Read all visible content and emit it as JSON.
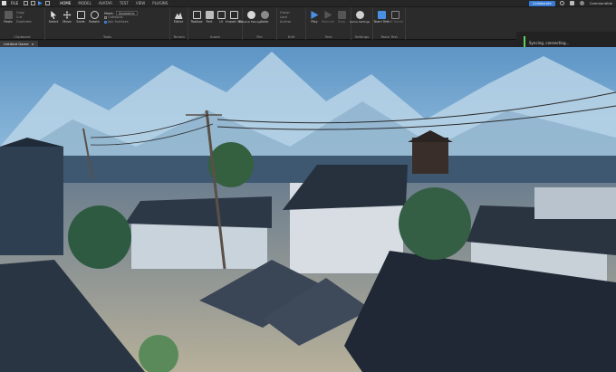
{
  "topbar": {
    "file_label": "FILE",
    "tabs": [
      "HOME",
      "MODEL",
      "AVATAR",
      "TEST",
      "VIEW",
      "PLUGINS"
    ],
    "active_tab": "HOME",
    "collaborate_label": "Collaborate",
    "user_name": "Commandida"
  },
  "ribbon": {
    "clipboard": {
      "label": "Clipboard",
      "items": [
        "Paste",
        "Copy",
        "Cut",
        "Duplicate"
      ]
    },
    "tools": {
      "label": "Tools",
      "items": [
        "Select",
        "Move",
        "Scale",
        "Rotate"
      ],
      "mode_label": "Mode:",
      "mode_value": "Geometric",
      "collisions_label": "Collisions",
      "join_surfaces_label": "Join Surfaces"
    },
    "terrain": {
      "label": "Terrain",
      "items": [
        "Editor"
      ]
    },
    "insert": {
      "label": "Insert",
      "items": [
        "Toolbox",
        "Part",
        "UI",
        "Import 3D"
      ]
    },
    "file": {
      "label": "File",
      "items": [
        "Material Manager",
        "Color"
      ]
    },
    "edit": {
      "label": "Edit",
      "items": [
        "Group",
        "Lock",
        "Anchor"
      ]
    },
    "test": {
      "label": "Test",
      "items": [
        "Play",
        "Resume",
        "Stop"
      ]
    },
    "settings": {
      "label": "Settings",
      "items": [
        "Game Settings"
      ]
    },
    "team_test": {
      "label": "Team Test",
      "items": [
        "Team Test",
        "Exit Game"
      ]
    }
  },
  "notification": {
    "text": "Syncing, connecting..."
  },
  "doc_tabs": [
    {
      "label": "Untitled Game"
    }
  ],
  "colors": {
    "accent": "#3a7bd5",
    "toolbar_bg": "#2b2b2b",
    "topbar_bg": "#262626"
  }
}
